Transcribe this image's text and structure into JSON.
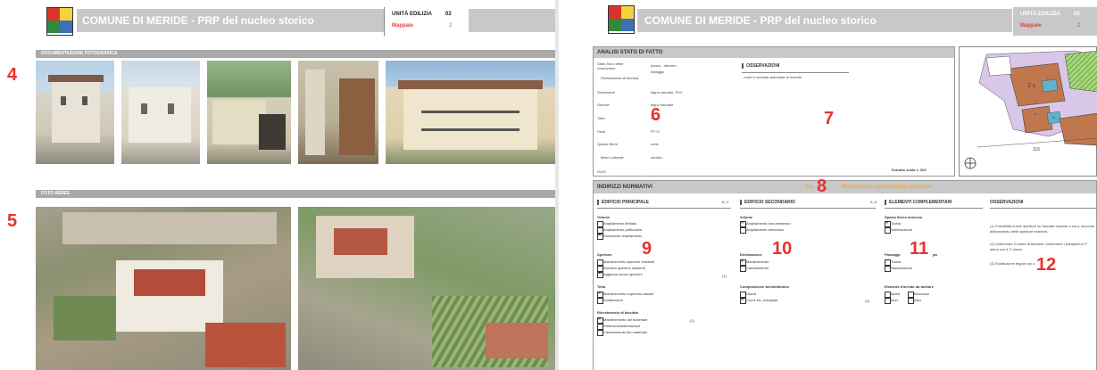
{
  "left": {
    "header_title": "COMUNE DI MERIDE - PRP del nucleo storico",
    "unita_label": "UNITÀ EDILIZIA",
    "unita_value": "02",
    "mappale_label": "Mappale",
    "mappale_value": "2",
    "section1": "DOCUMENTAZIONE FOTOGRAFICA",
    "section2": "FOTO AEREE",
    "num4": "4",
    "num5": "5"
  },
  "right": {
    "header_title": "COMUNE DI MERIDE - PRP del nucleo storico",
    "unita_label": "UNITÀ EDILIZIA",
    "unita_value": "02",
    "mappale_label": "Mappale",
    "mappale_value": "2",
    "analisi": {
      "title": "ANALISI STATO DI FATTO",
      "rows": [
        {
          "label": "Stato fisico delle costruzione",
          "value": "buono - discreto"
        },
        {
          "label": "",
          "value": "tinteggio"
        },
        {
          "label": "Rivestimento di facciata",
          "value": ""
        },
        {
          "label": "Serramenti",
          "value": "legno naturale, PVC"
        },
        {
          "label": "Gelosie",
          "value": "legno naturale"
        },
        {
          "label": "Tetto",
          "value": "coppi"
        },
        {
          "label": "Piani",
          "value": "PT+2"
        },
        {
          "label": "Spazio libero",
          "value": "corte"
        },
        {
          "label": "Bene culturale",
          "value": "censito"
        },
        {
          "label": "ISOS",
          "value": ""
        }
      ],
      "osservazioni_title": "OSSERVAZIONI",
      "osservazioni_text": "- corte in selciato sistemata di recente",
      "estratto": "Estratto scala 1: 500",
      "num6": "6",
      "num7": "7"
    },
    "map": {
      "label_2c": "2 c",
      "label_116": "116",
      "label_c": "c",
      "label_b": "b",
      "label_a": "A"
    },
    "indirizzi": {
      "title": "INDIRIZZI NORMATIVI",
      "categoria_prefix": "Ca",
      "categoria_label": "Riattamento conservativo semplice",
      "num8": "8",
      "num9": "9",
      "num10": "10",
      "num11": "11",
      "num12": "12",
      "ed_principale": "EDIFICIO PRINCIPALE",
      "ed_principale_ref": "B, C",
      "ed_secondario": "EDIFICIO SECONDARIO",
      "ed_secondario_ref": "A, E",
      "elementi": "ELEMENTI COMPLEMENTARI",
      "osservazioni": "OSSERVAZIONI",
      "p_volume": "Volume",
      "p_vol_1": "Ampliamento limitato",
      "p_vol_2": "Ampliamento particolare",
      "p_vol_3": "Esclusione ampliamento",
      "p_aperture": "Aperture",
      "p_ap_1": "Mantenimento aperture esistenti",
      "p_ap_2": "Riordino aperture esistenti",
      "p_ap_3": "Aggiunta nuove aperture",
      "p_ap_ref": "(1)",
      "p_tetto": "Tetto",
      "p_te_1": "Mantenimento copertura attuale",
      "p_te_2": "Sostituzione",
      "p_rivest": "Rivestimento di facciata",
      "p_ri_1": "Mantenimento del materiale",
      "p_ri_ref": "(2)",
      "p_ri_2": "Rinfresco/sistemazione",
      "p_ri_3": "Cambiamento del materiale",
      "s_volume": "Volume",
      "s_vol_1": "Ampliamento non ammesso",
      "s_vol_2": "Ampliamento ammesso",
      "s_destinaz": "Destinazione",
      "s_de_1": "Mantenimento",
      "s_de_2": "Cambiamento",
      "s_comp": "Composizione architettonica",
      "s_co_1": "Libera",
      "s_co_2": "Come ed. principale",
      "s_co_ref": "(3)",
      "e_spazio": "Spazio libero annesso",
      "e_sp_1": "Tutela",
      "e_sp_2": "Sistemazione",
      "e_passaggi": "Passaggi",
      "e_passaggi_tail": "pa",
      "e_pa_1": "Tutela",
      "e_pa_2": "Sistemazione",
      "e_arredo": "Elementi d'arredo da tutelare",
      "e_ar_1": "Alberi",
      "e_ar_2": "Bercesau",
      "e_ar_3": "Muri",
      "e_ar_4": "Altro",
      "obs_1": "(1) Possibilità nuove aperture su facciate esposte a nord, secondo allineamento delle aperture esistenti.",
      "obs_2": "(2) Uniformare il colore di facciata. Uniformare i parapetti al 2° piano con il 1° piano.",
      "obs_3": "(3) Sostituzione tegole con c"
    }
  }
}
